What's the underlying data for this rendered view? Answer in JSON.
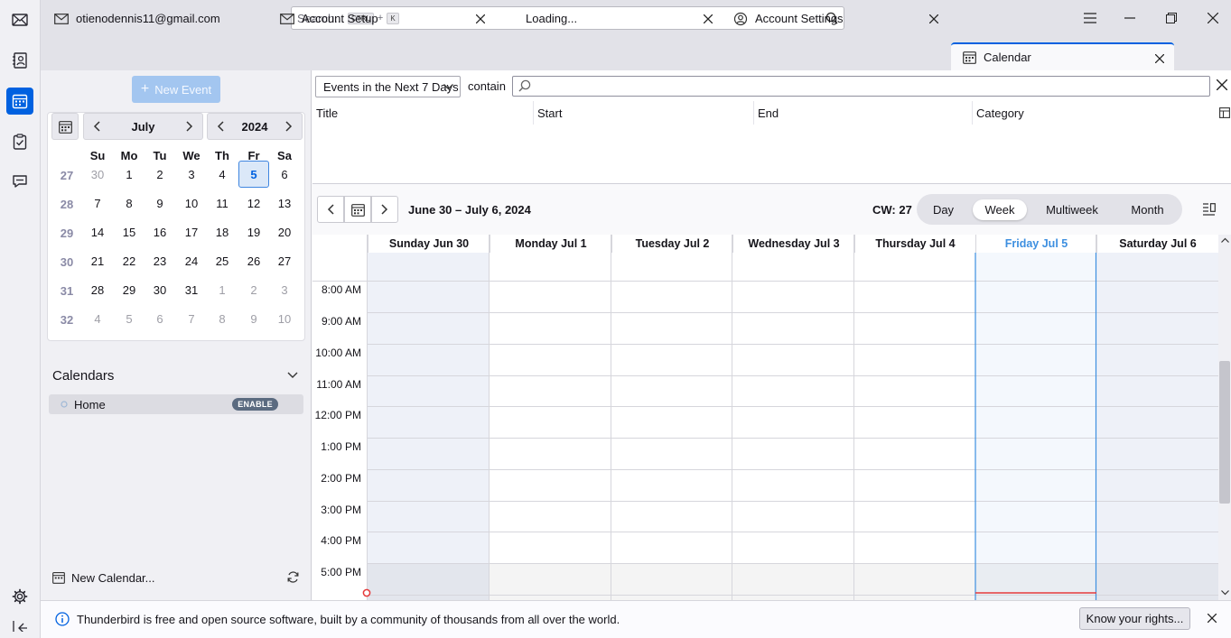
{
  "search": {
    "placeholder": "Search...",
    "shortcut_ctrl": "CTRL",
    "shortcut_plus": "+",
    "shortcut_key": "K"
  },
  "tabs": [
    {
      "label": "otienodennis11@gmail.com"
    },
    {
      "label": "Account Setup"
    },
    {
      "label": "Loading..."
    },
    {
      "label": "Account Settings"
    },
    {
      "label": "Calendar"
    }
  ],
  "sidebar": {
    "new_event": "New Event",
    "month": "July",
    "year": "2024",
    "day_headers": [
      "Su",
      "Mo",
      "Tu",
      "We",
      "Th",
      "Fr",
      "Sa"
    ],
    "weeks": [
      {
        "wk": "27",
        "days": [
          "30",
          "1",
          "2",
          "3",
          "4",
          "5",
          "6"
        ]
      },
      {
        "wk": "28",
        "days": [
          "7",
          "8",
          "9",
          "10",
          "11",
          "12",
          "13"
        ]
      },
      {
        "wk": "29",
        "days": [
          "14",
          "15",
          "16",
          "17",
          "18",
          "19",
          "20"
        ]
      },
      {
        "wk": "30",
        "days": [
          "21",
          "22",
          "23",
          "24",
          "25",
          "26",
          "27"
        ]
      },
      {
        "wk": "31",
        "days": [
          "28",
          "29",
          "30",
          "31",
          "1",
          "2",
          "3"
        ]
      },
      {
        "wk": "32",
        "days": [
          "4",
          "5",
          "6",
          "7",
          "8",
          "9",
          "10"
        ]
      }
    ],
    "calendars_header": "Calendars",
    "calendar_name": "Home",
    "enable_badge": "ENABLE",
    "new_calendar": "New Calendar..."
  },
  "unifinder": {
    "filter": "Events in the Next 7 Days",
    "contain": "contain",
    "columns": [
      "Title",
      "Start",
      "End",
      "Category"
    ]
  },
  "toolbar": {
    "range": "June 30 – July 6, 2024",
    "cw": "CW: 27",
    "views": [
      "Day",
      "Week",
      "Multiweek",
      "Month"
    ],
    "selected_view": "Week"
  },
  "week": {
    "days": [
      "Sunday Jun 30",
      "Monday Jul 1",
      "Tuesday Jul 2",
      "Wednesday Jul 3",
      "Thursday Jul 4",
      "Friday Jul 5",
      "Saturday Jul 6"
    ],
    "hours": [
      "8:00 AM",
      "9:00 AM",
      "10:00 AM",
      "11:00 AM",
      "12:00 PM",
      "1:00 PM",
      "2:00 PM",
      "3:00 PM",
      "4:00 PM",
      "5:00 PM"
    ]
  },
  "notification": {
    "text": "Thunderbird is free and open source software, built by a community of thousands from all over the world.",
    "button": "Know your rights..."
  },
  "colors": {
    "accent": "#0061e0",
    "today": "#3d8fe0",
    "weekend": "#eef1f8",
    "now_line": "#e53a3a"
  }
}
